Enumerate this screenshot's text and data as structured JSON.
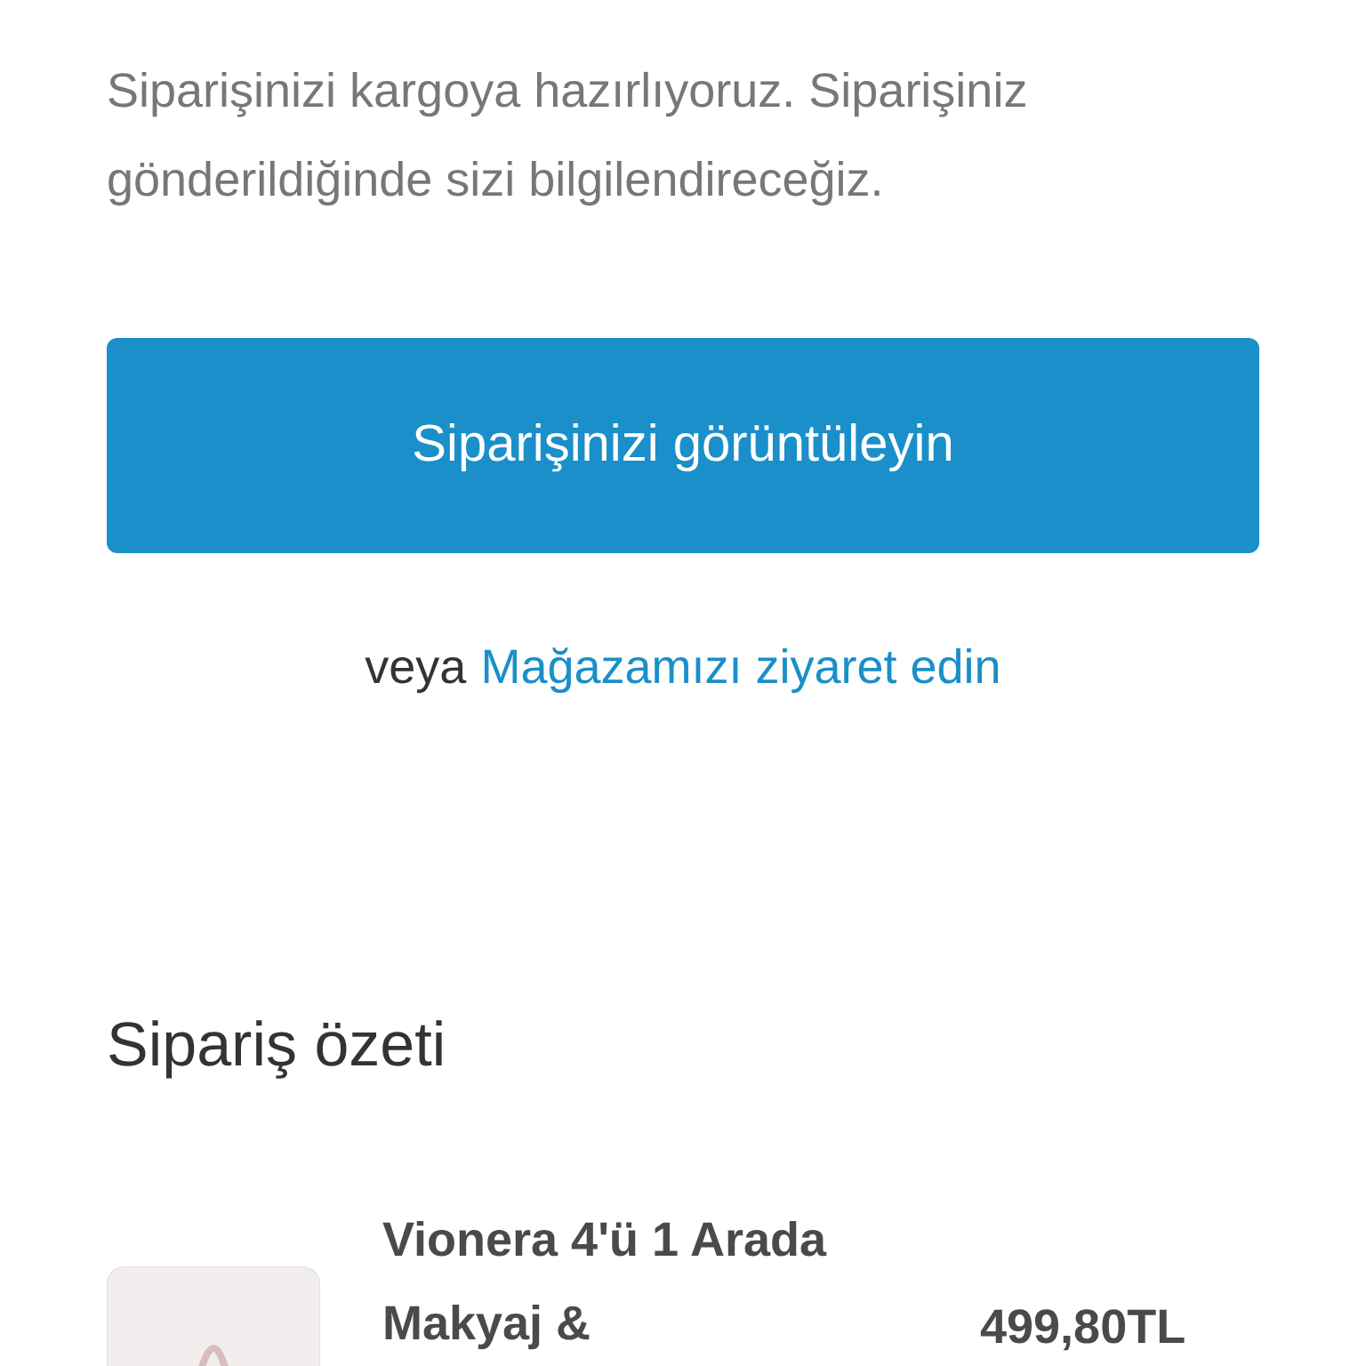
{
  "message": "Siparişinizi kargoya hazırlıyoruz. Siparişiniz gönderildiğinde sizi bilgilendireceğiz.",
  "primary_button": "Siparişinizi görüntüleyin",
  "alternative": {
    "prefix": "veya",
    "link": "Mağazamızı ziyaret edin"
  },
  "summary": {
    "title": "Sipariş özeti",
    "items": [
      {
        "name": "Vionera 4'ü 1 Arada Makyaj &",
        "price": "499,80TL"
      }
    ]
  }
}
